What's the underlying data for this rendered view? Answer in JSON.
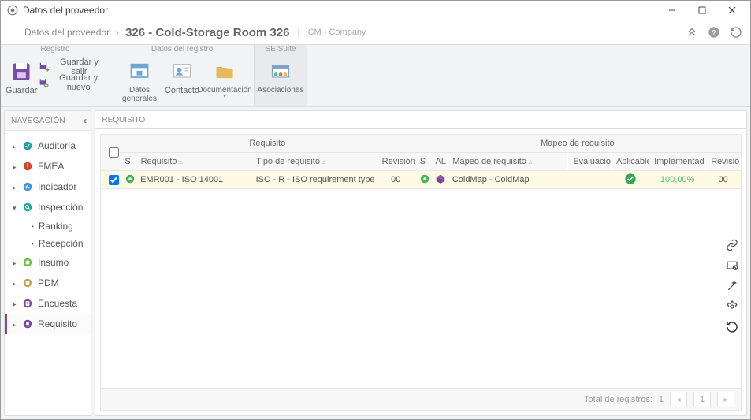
{
  "window": {
    "title": "Datos del proveedor"
  },
  "breadcrumb": {
    "root": "Datos del proveedor",
    "current": "326 - Cold-Storage Room 326",
    "company": "CM - Company"
  },
  "header_icons": {
    "collapse": "chevron-double-up",
    "help": "help",
    "refresh": "refresh"
  },
  "ribbon": {
    "groups": {
      "registro": {
        "header": "Registro",
        "save": "Guardar",
        "save_exit": "Guardar y salir",
        "save_new": "Guardar y nuevo"
      },
      "datos_registro": {
        "header": "Datos del registro",
        "general": "Datos generales",
        "contact": "Contacto",
        "documentation": "Documentación"
      },
      "se_suite": {
        "header": "SE Suite",
        "associations": "Asociaciones"
      }
    }
  },
  "nav": {
    "header": "NAVEGACIÓN",
    "items": [
      {
        "label": "Auditoría",
        "expanded": false,
        "color": "#1aa3a3"
      },
      {
        "label": "FMEA",
        "expanded": false,
        "color": "#d2452f"
      },
      {
        "label": "Indicador",
        "expanded": false,
        "color": "#3b98d8"
      },
      {
        "label": "Inspección",
        "expanded": true,
        "color": "#17a69a",
        "children": [
          {
            "label": "Ranking"
          },
          {
            "label": "Recepción"
          }
        ]
      },
      {
        "label": "Insumo",
        "expanded": false,
        "color": "#6cbf3f"
      },
      {
        "label": "PDM",
        "expanded": false,
        "color": "#c7a14a"
      },
      {
        "label": "Encuesta",
        "expanded": false,
        "color": "#7a4aa5"
      },
      {
        "label": "Requisito",
        "expanded": false,
        "color": "#7a4aa5",
        "active": true
      }
    ]
  },
  "content": {
    "panel_header": "REQUISITO",
    "grid": {
      "group_headers": {
        "requisito": "Requisito",
        "mapeo": "Mapeo de requisito"
      },
      "columns": {
        "chk": "",
        "s1": "S",
        "requisito": "Requisito",
        "tipo": "Tipo de requisito",
        "revision1": "Revisión",
        "s2": "S",
        "al": "AL",
        "mapeo": "Mapeo de requisito",
        "evaluacion": "Evaluación",
        "aplicable": "Aplicable",
        "implementado": "Implementado",
        "revision2": "Revisión"
      },
      "rows": [
        {
          "checked": true,
          "status1": "green-gear",
          "requisito": "EMR001 - ISO 14001",
          "tipo": "ISO - R - ISO requirement type",
          "revision1": "00",
          "s2": "green-gear",
          "al": "purple-cube",
          "mapeo": "ColdMap - ColdMap",
          "evaluacion": "",
          "aplicable": "check",
          "implementado": "100,00%",
          "revision2": "00"
        }
      ]
    },
    "pager": {
      "total_label": "Total de registros:",
      "total": "1",
      "current_page": "1"
    }
  }
}
